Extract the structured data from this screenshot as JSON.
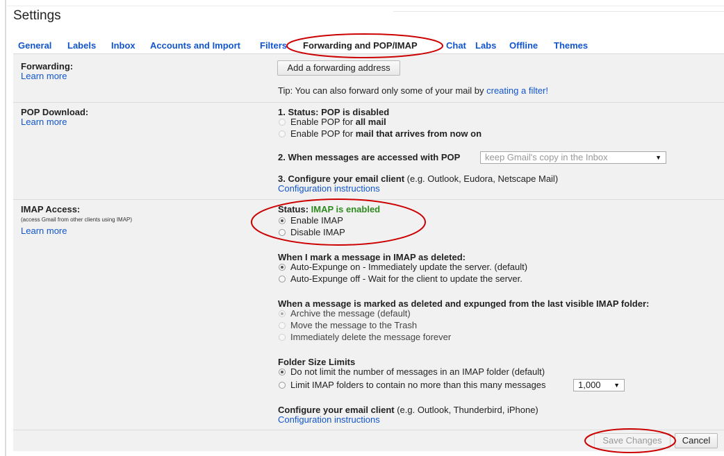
{
  "header": {
    "title": "Settings"
  },
  "tabs": [
    {
      "label": "General"
    },
    {
      "label": "Labels"
    },
    {
      "label": "Inbox"
    },
    {
      "label": "Accounts and Import"
    },
    {
      "label": "Filters"
    },
    {
      "label": "Forwarding and POP/IMAP"
    },
    {
      "label": "Chat"
    },
    {
      "label": "Labs"
    },
    {
      "label": "Offline"
    },
    {
      "label": "Themes"
    }
  ],
  "active_tab": "Forwarding and POP/IMAP",
  "forwarding": {
    "label": "Forwarding:",
    "learn_more": "Learn more",
    "add_button": "Add a forwarding address",
    "tip_prefix": "Tip: You can also forward only some of your mail by ",
    "tip_link": "creating a filter!"
  },
  "pop": {
    "label": "POP Download:",
    "learn_more": "Learn more",
    "status": "1. Status: POP is disabled",
    "opt1_prefix": "Enable POP for ",
    "opt1_bold": "all mail",
    "opt2_prefix": "Enable POP for ",
    "opt2_bold": "mail that arrives from now on",
    "access_label": "2. When messages are accessed with POP",
    "access_select": "keep Gmail's copy in the Inbox",
    "configure_bold": "3. Configure your email client",
    "configure_rest": " (e.g. Outlook, Eudora, Netscape Mail)",
    "config_link": "Configuration instructions"
  },
  "imap": {
    "label": "IMAP Access:",
    "sub": "(access Gmail from other clients using IMAP)",
    "learn_more": "Learn more",
    "status_prefix": "Status: ",
    "status_value": "IMAP is enabled",
    "enable": "Enable IMAP",
    "disable": "Disable IMAP",
    "enabled": true,
    "deleted_heading": "When I mark a message in IMAP as deleted:",
    "expunge_on": "Auto-Expunge on - Immediately update the server. (default)",
    "expunge_off": "Auto-Expunge off - Wait for the client to update the server.",
    "expunged_heading": "When a message is marked as deleted and expunged from the last visible IMAP folder:",
    "archive": "Archive the message (default)",
    "trash": "Move the message to the Trash",
    "delete_forever": "Immediately delete the message forever",
    "folder_heading": "Folder Size Limits",
    "no_limit": "Do not limit the number of messages in an IMAP folder (default)",
    "limit": "Limit IMAP folders to contain no more than this many messages",
    "limit_value": "1,000",
    "configure_bold": "Configure your email client",
    "configure_rest": " (e.g. Outlook, Thunderbird, iPhone)",
    "config_link": "Configuration instructions"
  },
  "footer": {
    "save": "Save Changes",
    "cancel": "Cancel"
  },
  "colors": {
    "link": "#1155cc",
    "enabled_status": "#2e8b1f",
    "annotation": "#cc0000",
    "panel_bg": "#f1f1f1"
  }
}
